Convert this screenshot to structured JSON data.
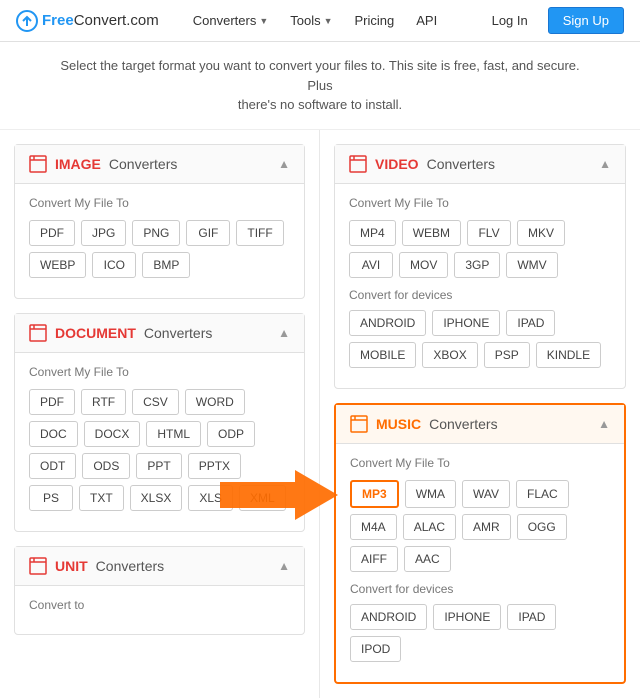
{
  "header": {
    "logo_free": "Free",
    "logo_convert": "Convert",
    "logo_domain": ".com",
    "nav": [
      {
        "label": "Converters",
        "has_dropdown": true
      },
      {
        "label": "Tools",
        "has_dropdown": true
      },
      {
        "label": "Pricing",
        "has_dropdown": false
      },
      {
        "label": "API",
        "has_dropdown": false
      }
    ],
    "login_label": "Log In",
    "signup_label": "Sign Up"
  },
  "subtitle": {
    "line1": "Select the target format you want to convert your files to. This site is free, fast, and secure. Plus",
    "line2": "there's no software to install."
  },
  "sections": {
    "image": {
      "icon": "📄",
      "bold_label": "IMAGE",
      "normal_label": " Converters",
      "convert_label": "Convert My File To",
      "formats": [
        "PDF",
        "JPG",
        "PNG",
        "GIF",
        "TIFF",
        "WEBP",
        "ICO",
        "BMP"
      ]
    },
    "document": {
      "icon": "📄",
      "bold_label": "DOCUMENT",
      "normal_label": " Converters",
      "convert_label": "Convert My File To",
      "formats": [
        "PDF",
        "RTF",
        "CSV",
        "WORD",
        "DOC",
        "DOCX",
        "HTML",
        "ODP",
        "ODT",
        "ODS",
        "PPT",
        "PPTX",
        "PS",
        "TXT",
        "XLSX",
        "XLS",
        "XML"
      ]
    },
    "unit": {
      "icon": "📄",
      "bold_label": "UNIT",
      "normal_label": " Converters",
      "convert_label": "Convert to"
    },
    "video": {
      "icon": "📄",
      "bold_label": "VIDEO",
      "normal_label": " Converters",
      "convert_label": "Convert My File To",
      "formats": [
        "MP4",
        "WEBM",
        "FLV",
        "MKV",
        "AVI",
        "MOV",
        "3GP",
        "WMV"
      ],
      "devices_label": "Convert for devices",
      "devices": [
        "ANDROID",
        "IPHONE",
        "IPAD",
        "MOBILE",
        "XBOX",
        "PSP",
        "KINDLE"
      ]
    },
    "music": {
      "icon": "📄",
      "bold_label": "MUSIC",
      "normal_label": " Converters",
      "convert_label": "Convert My File To",
      "formats": [
        "MP3",
        "WMA",
        "WAV",
        "FLAC",
        "M4A",
        "ALAC",
        "AMR",
        "OGG",
        "AIFF",
        "AAC"
      ],
      "devices_label": "Convert for devices",
      "devices": [
        "ANDROID",
        "IPHONE",
        "IPAD",
        "IPOD"
      ],
      "highlighted_format": "MP3"
    }
  },
  "arrow": {
    "color": "#FF6D00"
  }
}
